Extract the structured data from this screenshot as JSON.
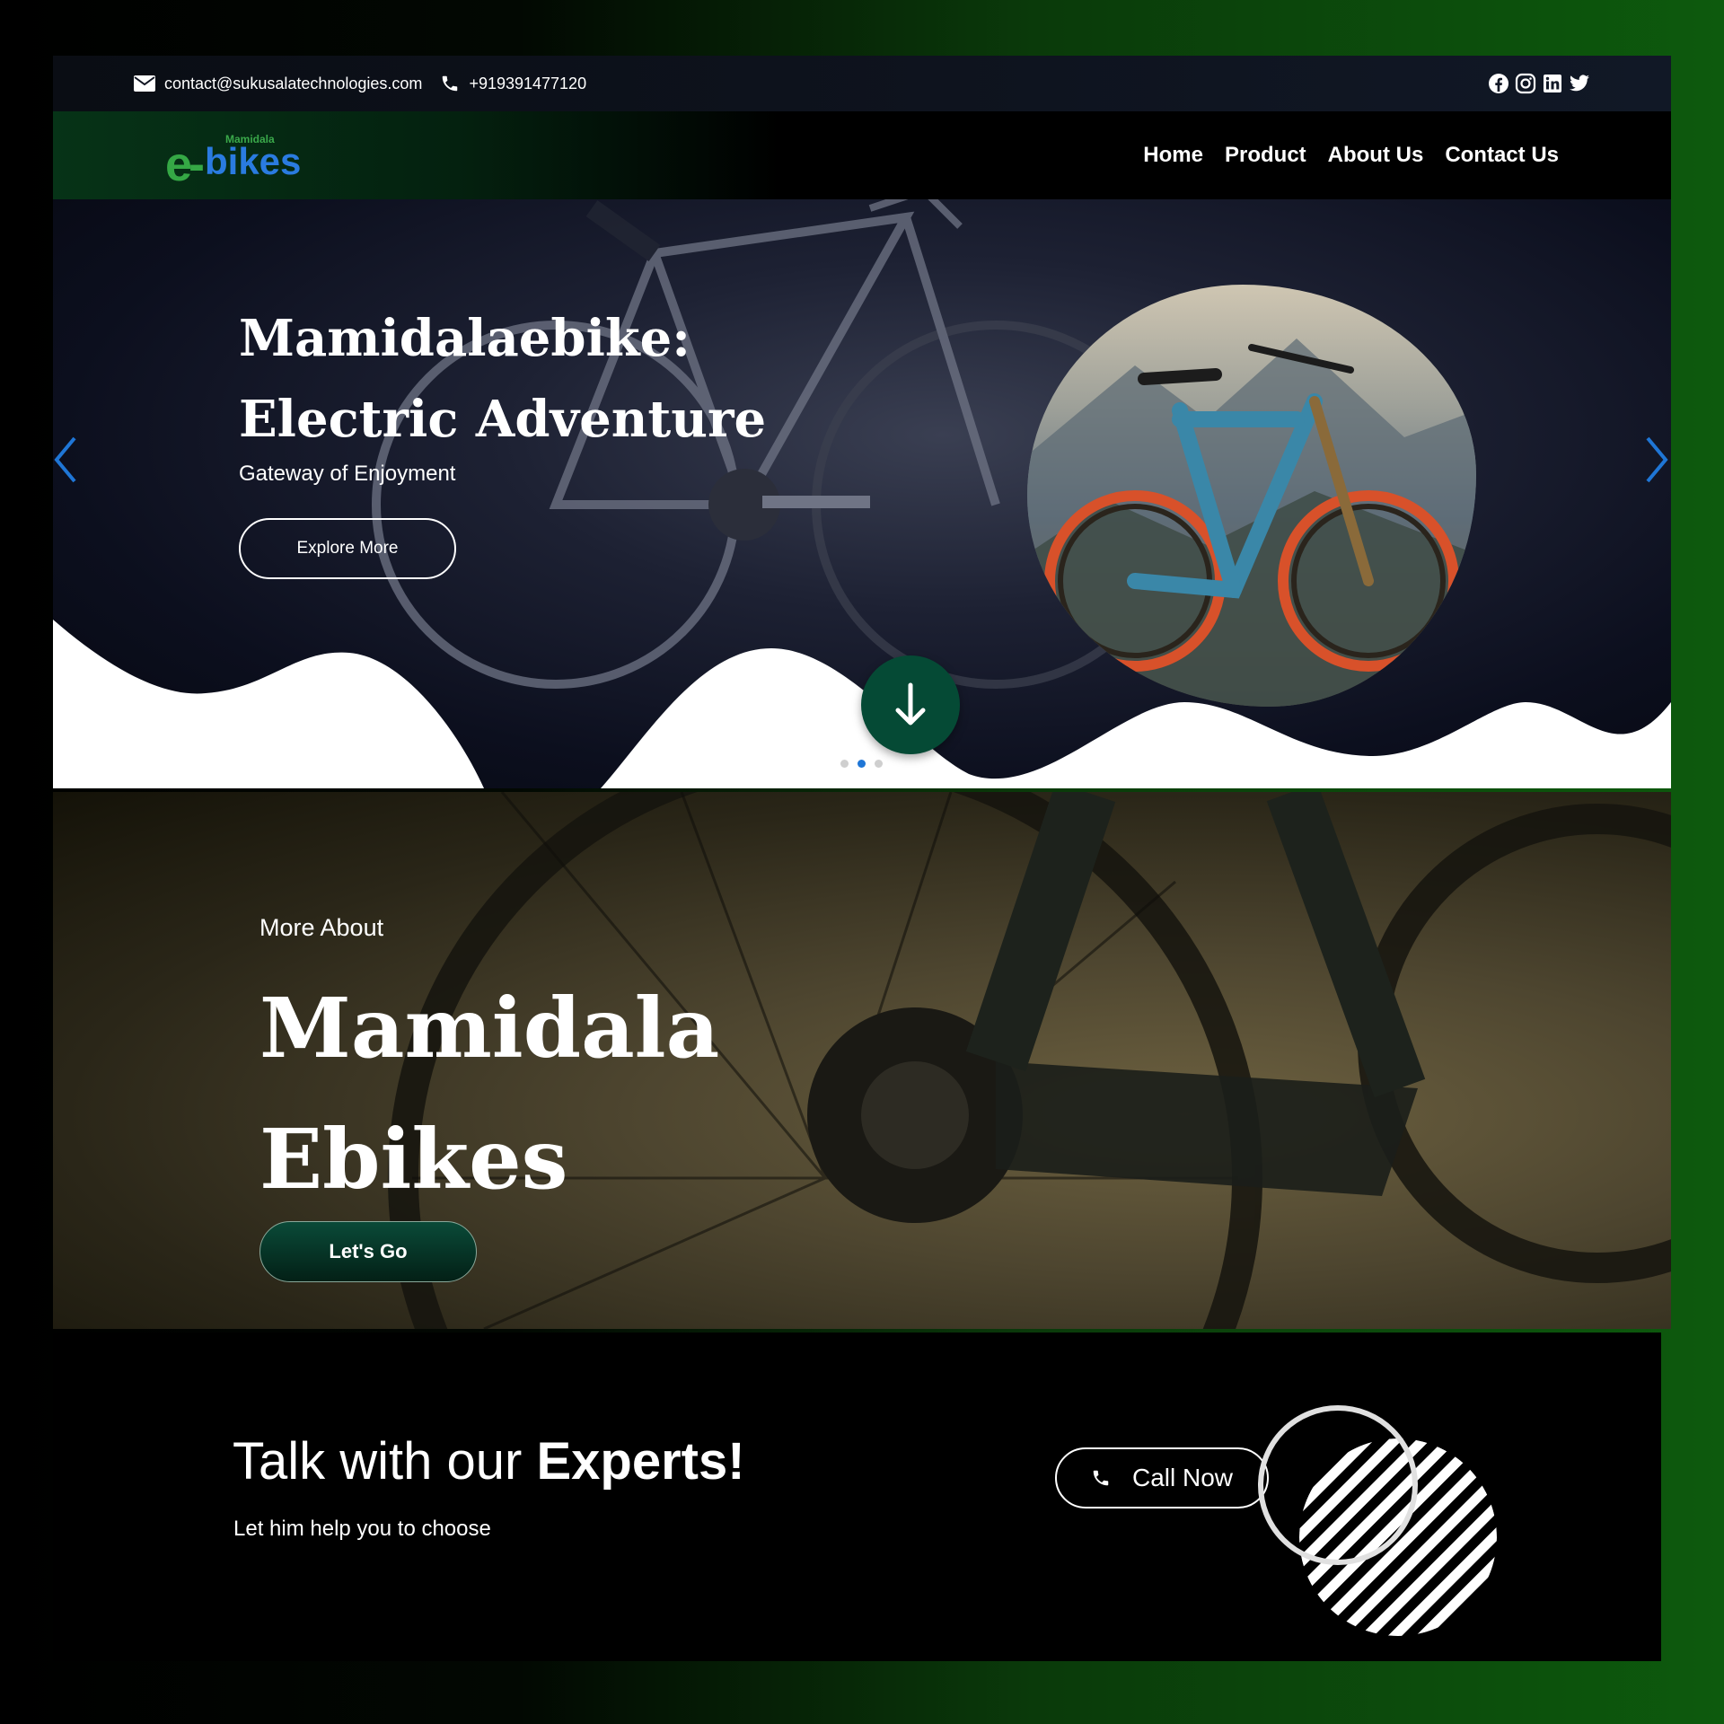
{
  "topbar": {
    "email": "contact@sukusalatechnologies.com",
    "phone": "+919391477120",
    "social_icons": [
      "facebook-icon",
      "instagram-icon",
      "linkedin-icon",
      "twitter-icon"
    ]
  },
  "brand": {
    "logo_small": "Mamidala",
    "logo_e": "e-",
    "logo_main": "bikes"
  },
  "nav": {
    "items": [
      {
        "label": "Home"
      },
      {
        "label": "Product"
      },
      {
        "label": "About Us"
      },
      {
        "label": "Contact Us"
      }
    ]
  },
  "hero": {
    "title": "Mamidalaebike: Electric Adventure",
    "subtitle": "Gateway of Enjoyment",
    "button": "Explore More",
    "slides": 3,
    "active_slide": 2
  },
  "about": {
    "label": "More About",
    "title_line1": "Mamidala",
    "title_line2": "Ebikes",
    "button": "Let's Go"
  },
  "experts": {
    "title_plain": "Talk with our ",
    "title_bold": "Experts!",
    "subtitle": "Let him help you to choose",
    "button": "Call Now"
  },
  "colors": {
    "accent_green": "#054a35",
    "active_dot": "#1f76d6",
    "chevron": "#1f76d6"
  }
}
